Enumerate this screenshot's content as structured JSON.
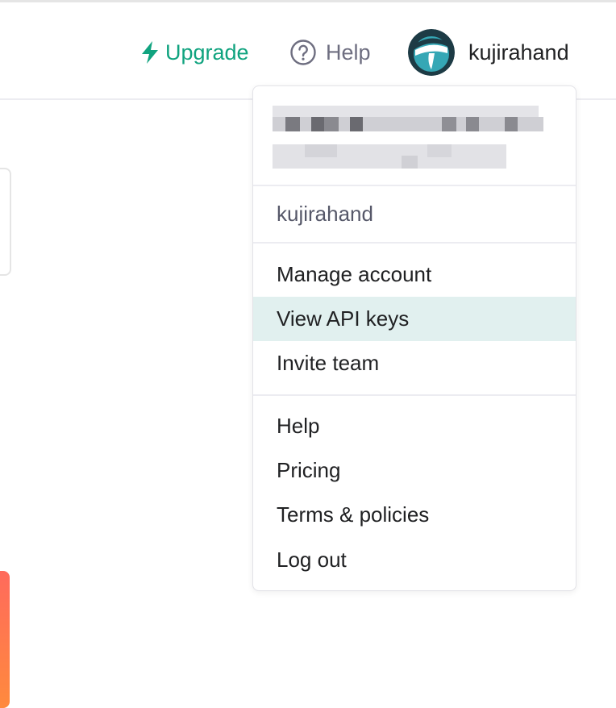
{
  "header": {
    "upgrade_label": "Upgrade",
    "help_label": "Help",
    "username": "kujirahand"
  },
  "menu": {
    "account_username": "kujirahand",
    "section_account": [
      {
        "label": "Manage account"
      },
      {
        "label": "View API keys",
        "highlighted": true
      },
      {
        "label": "Invite team"
      }
    ],
    "section_info": [
      {
        "label": "Help"
      },
      {
        "label": "Pricing"
      },
      {
        "label": "Terms & policies"
      },
      {
        "label": "Log out"
      }
    ]
  },
  "colors": {
    "accent": "#10a37f",
    "muted_text": "#6e6e80",
    "highlight_bg": "#e1f0ef",
    "orange": "#ff7a4a"
  },
  "icons": {
    "upgrade": "lightning-bolt-icon",
    "help": "question-circle-icon",
    "avatar": "user-avatar"
  }
}
